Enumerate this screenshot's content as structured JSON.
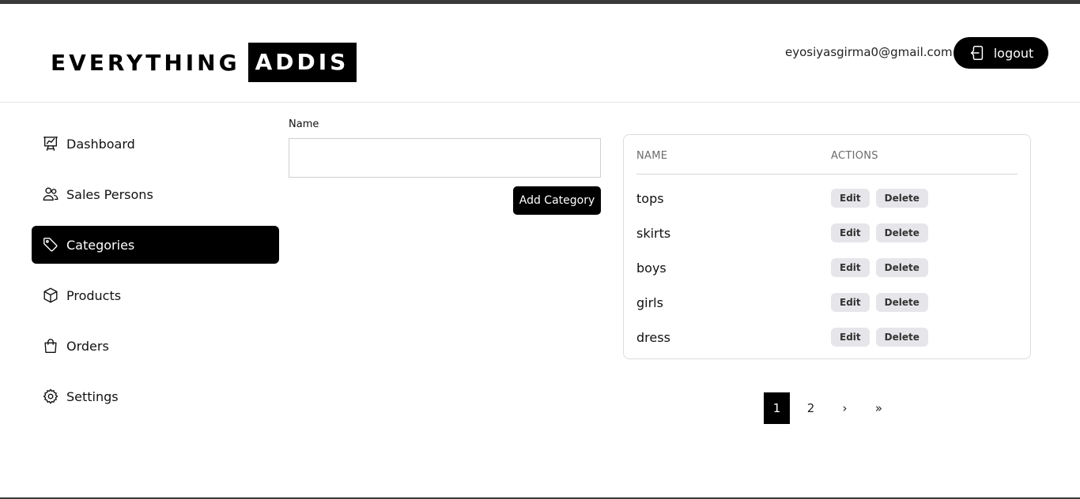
{
  "header": {
    "logo_part1": "EVERYTHING",
    "logo_part2": "ADDIS",
    "user_email": "eyosiyasgirma0@gmail.com",
    "logout_label": "logout"
  },
  "sidebar": {
    "items": [
      {
        "label": "Dashboard",
        "icon": "presentation-chart-icon"
      },
      {
        "label": "Sales Persons",
        "icon": "users-icon"
      },
      {
        "label": "Categories",
        "icon": "tag-icon",
        "active": true
      },
      {
        "label": "Products",
        "icon": "cube-icon"
      },
      {
        "label": "Orders",
        "icon": "shopping-bag-icon"
      },
      {
        "label": "Settings",
        "icon": "gear-icon"
      }
    ]
  },
  "form": {
    "name_label": "Name",
    "name_value": "",
    "add_button_label": "Add Category"
  },
  "table": {
    "columns": [
      "NAME",
      "ACTIONS"
    ],
    "rows": [
      {
        "name": "tops"
      },
      {
        "name": "skirts"
      },
      {
        "name": "boys"
      },
      {
        "name": "girls"
      },
      {
        "name": "dress"
      }
    ],
    "edit_label": "Edit",
    "delete_label": "Delete"
  },
  "pagination": {
    "pages": [
      "1",
      "2"
    ],
    "current": "1",
    "next_symbol": "›",
    "last_symbol": "»"
  },
  "colors": {
    "accent": "#000000",
    "chip_bg": "#e6e6ea",
    "border": "#dcdcdc"
  }
}
